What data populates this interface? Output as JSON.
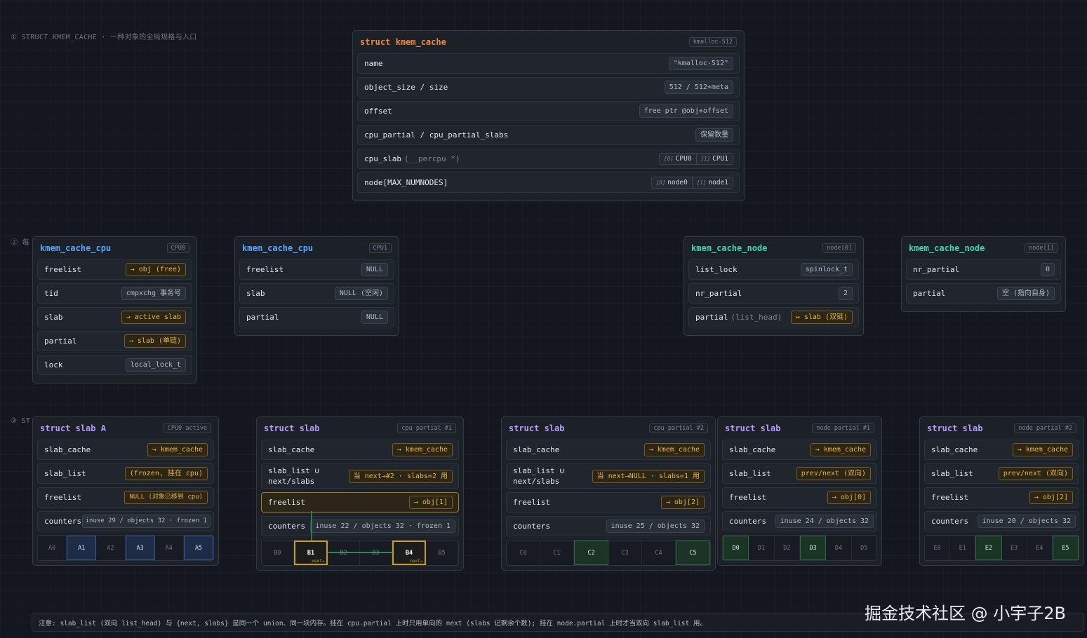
{
  "sections": {
    "s1": "① STRUCT KMEM_CACHE · 一种对象的全局规格与入口",
    "s2": "② 每",
    "s3": "③ ST"
  },
  "kmem_cache": {
    "title": "struct kmem_cache",
    "tag": "kmalloc-512",
    "rows": [
      {
        "label": "name",
        "value": "\"kmalloc-512\""
      },
      {
        "label": "object_size / size",
        "value": "512 / 512+meta"
      },
      {
        "label": "offset",
        "value": "free ptr @obj+offset"
      },
      {
        "label": "cpu_partial / cpu_partial_slabs",
        "value": "保留数量"
      },
      {
        "label": "cpu_slab",
        "sublabel": "(__percpu *)",
        "items": [
          {
            "idx": "[0]",
            "val": "CPU0"
          },
          {
            "idx": "[1]",
            "val": "CPU1"
          }
        ]
      },
      {
        "label": "node[MAX_NUMNODES]",
        "items": [
          {
            "idx": "[0]",
            "val": "node0"
          },
          {
            "idx": "[1]",
            "val": "node1"
          }
        ]
      }
    ]
  },
  "cpu0": {
    "title": "kmem_cache_cpu",
    "tag": "CPU0",
    "rows": [
      {
        "label": "freelist",
        "value": "→ obj (free)"
      },
      {
        "label": "tid",
        "value": "cmpxchg 事务号"
      },
      {
        "label": "slab",
        "value": "→ active slab"
      },
      {
        "label": "partial",
        "value": "→ slab (单链)"
      },
      {
        "label": "lock",
        "value": "local_lock_t"
      }
    ]
  },
  "cpu1": {
    "title": "kmem_cache_cpu",
    "tag": "CPU1",
    "rows": [
      {
        "label": "freelist",
        "value": "NULL"
      },
      {
        "label": "slab",
        "value": "NULL (空闲)"
      },
      {
        "label": "partial",
        "value": "NULL"
      }
    ]
  },
  "node0": {
    "title": "kmem_cache_node",
    "tag": "node[0]",
    "rows": [
      {
        "label": "list_lock",
        "value": "spinlock_t"
      },
      {
        "label": "nr_partial",
        "value": "2"
      },
      {
        "label": "partial",
        "sublabel": "(list_head)",
        "value": "↔ slab (双链)"
      }
    ]
  },
  "node1": {
    "title": "kmem_cache_node",
    "tag": "node[1]",
    "rows": [
      {
        "label": "nr_partial",
        "value": "0"
      },
      {
        "label": "partial",
        "value": "空 (指向自身)"
      }
    ]
  },
  "slabA": {
    "title": "struct slab A",
    "tag": "CPU0 active",
    "rows": [
      {
        "label": "slab_cache",
        "value": "→ kmem_cache"
      },
      {
        "label": "slab_list",
        "value": "(frozen, 挂在 cpu)"
      },
      {
        "label": "freelist",
        "value": "NULL (对象已移到 cpu)"
      },
      {
        "label": "counters",
        "value": "inuse 29 / objects 32 · frozen 1"
      }
    ],
    "objs": [
      "A0",
      "A1",
      "A2",
      "A3",
      "A4",
      "A5"
    ]
  },
  "slabB": {
    "title": "struct slab",
    "tag": "cpu partial #1",
    "rows": [
      {
        "label": "slab_cache",
        "value": "→ kmem_cache"
      },
      {
        "label": "slab_list ∪",
        "label2": "next/slabs",
        "value": "当 next→#2 · slabs=2 用"
      },
      {
        "label": "freelist",
        "value": "→ obj[1]"
      },
      {
        "label": "counters",
        "value": "inuse 22 / objects 32 · frozen 1"
      }
    ],
    "objs": [
      "B0",
      "B1",
      "B2",
      "B3",
      "B4",
      "B5"
    ],
    "next_label": "next→"
  },
  "slabC": {
    "title": "struct slab",
    "tag": "cpu partial #2",
    "rows": [
      {
        "label": "slab_cache",
        "value": "→ kmem_cache"
      },
      {
        "label": "slab_list ∪",
        "label2": "next/slabs",
        "value": "当 next→NULL · slabs=1 用"
      },
      {
        "label": "freelist",
        "value": "→ obj[2]"
      },
      {
        "label": "counters",
        "value": "inuse 25 / objects 32"
      }
    ],
    "objs": [
      "C0",
      "C1",
      "C2",
      "C3",
      "C4",
      "C5"
    ]
  },
  "slabD": {
    "title": "struct slab",
    "tag": "node partial #1",
    "rows": [
      {
        "label": "slab_cache",
        "value": "→ kmem_cache"
      },
      {
        "label": "slab_list",
        "value": "prev/next (双向)"
      },
      {
        "label": "freelist",
        "value": "→ obj[0]"
      },
      {
        "label": "counters",
        "value": "inuse 24 / objects 32"
      }
    ],
    "objs": [
      "D0",
      "D1",
      "D2",
      "D3",
      "D4",
      "D5"
    ]
  },
  "slabE": {
    "title": "struct slab",
    "tag": "node partial #2",
    "rows": [
      {
        "label": "slab_cache",
        "value": "→ kmem_cache"
      },
      {
        "label": "slab_list",
        "value": "prev/next (双向)"
      },
      {
        "label": "freelist",
        "value": "→ obj[2]"
      },
      {
        "label": "counters",
        "value": "inuse 20 / objects 32"
      }
    ],
    "objs": [
      "E0",
      "E1",
      "E2",
      "E3",
      "E4",
      "E5"
    ]
  },
  "note": "注意: slab_list (双向 list_head) 与 {next, slabs} 是同一个 union、同一块内存。挂在 cpu.partial 上时只用单向的 next (slabs 记剩余个数); 挂在 node.partial 上时才当双向 slab_list 用。",
  "watermark": "掘金技术社区 @ 小宇子2B",
  "colors": {
    "orange": "#f0883e",
    "blue": "#58a6ff",
    "teal": "#3dd6b3",
    "purple": "#b49cff",
    "highlight": "#c59d2a",
    "green": "#2b6a40"
  }
}
